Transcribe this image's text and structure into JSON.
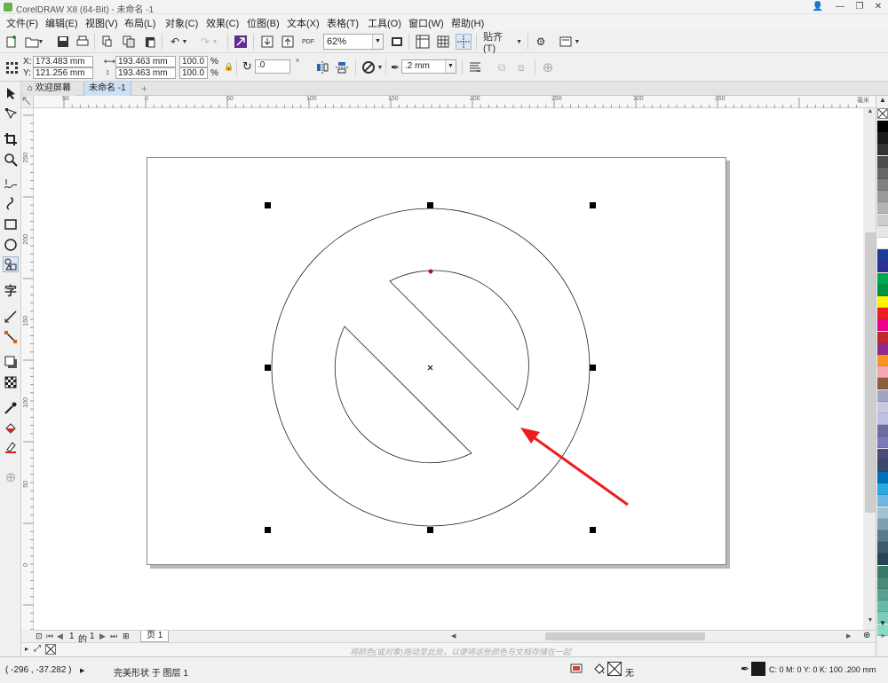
{
  "app": {
    "title": "CorelDRAW X8 (64-Bit) - 未命名 -1"
  },
  "menu": [
    "文件(F)",
    "编辑(E)",
    "视图(V)",
    "布局(L)",
    "对象(C)",
    "效果(C)",
    "位图(B)",
    "文本(X)",
    "表格(T)",
    "工具(O)",
    "窗口(W)",
    "帮助(H)"
  ],
  "toolbar": {
    "zoom_value": "62%",
    "snap_label": "贴齐(T)",
    "pdf_label": "PDF"
  },
  "property_bar": {
    "x_label": "X:",
    "x_value": "173.483 mm",
    "y_label": "Y:",
    "y_value": "121.256 mm",
    "width_value": "193.463 mm",
    "height_value": "193.463 mm",
    "scale_w": "100.0",
    "scale_h": "100.0",
    "percent": "%",
    "rotation_value": ".0",
    "degree": "°",
    "outline_width": ".2 mm"
  },
  "tabs": [
    {
      "label": "欢迎屏幕",
      "active": false
    },
    {
      "label": "未命名 -1",
      "active": true
    }
  ],
  "ruler": {
    "h_ticks": [
      "50",
      "0",
      "50",
      "100",
      "150",
      "200",
      "250",
      "300",
      "350"
    ],
    "v_ticks": [
      "250",
      "200",
      "150",
      "100",
      "50",
      "0"
    ],
    "unit": "毫米"
  },
  "page_nav": {
    "current": "1",
    "of": "的",
    "total": "1",
    "page_tab": "页 1"
  },
  "color_hint": "将颜色(或对象)拖动至此处，以便将这些颜色与文档存储在一起",
  "status": {
    "coords": "( -296 , -37.282 )",
    "object_info": "完美形状 于 图层 1",
    "fill_none": "无",
    "outline_info": "C: 0 M: 0 Y: 0 K: 100  .200 mm"
  },
  "colors": {
    "accent_red": "#ee1c1c",
    "node_red": "#cc0000"
  },
  "palette": [
    "#000000",
    "#1a1a1a",
    "#333333",
    "#4d4d4d",
    "#666666",
    "#808080",
    "#999999",
    "#b3b3b3",
    "#cccccc",
    "#e6e6e6",
    "#ffffff",
    "#1f3c9b",
    "#2e3192",
    "#00a651",
    "#009245",
    "#fff200",
    "#ed1c24",
    "#ec008c",
    "#c1272d",
    "#92278f",
    "#f7941d",
    "#f6a6b2",
    "#8b5e3c",
    "#a3a3c2",
    "#c8c8e0",
    "#bfbfe8",
    "#6d6d9e",
    "#7a7ab8",
    "#4b4b7a",
    "#3a4a6b",
    "#0072bc",
    "#29abe2",
    "#6fb7e4",
    "#a0c4d0",
    "#7fa0b0",
    "#5a7a8a",
    "#3d5a6b",
    "#2b4455",
    "#3a7a6a",
    "#4a8a7a",
    "#5aa090",
    "#6ab8a6",
    "#7ccab8",
    "#8adac8"
  ]
}
